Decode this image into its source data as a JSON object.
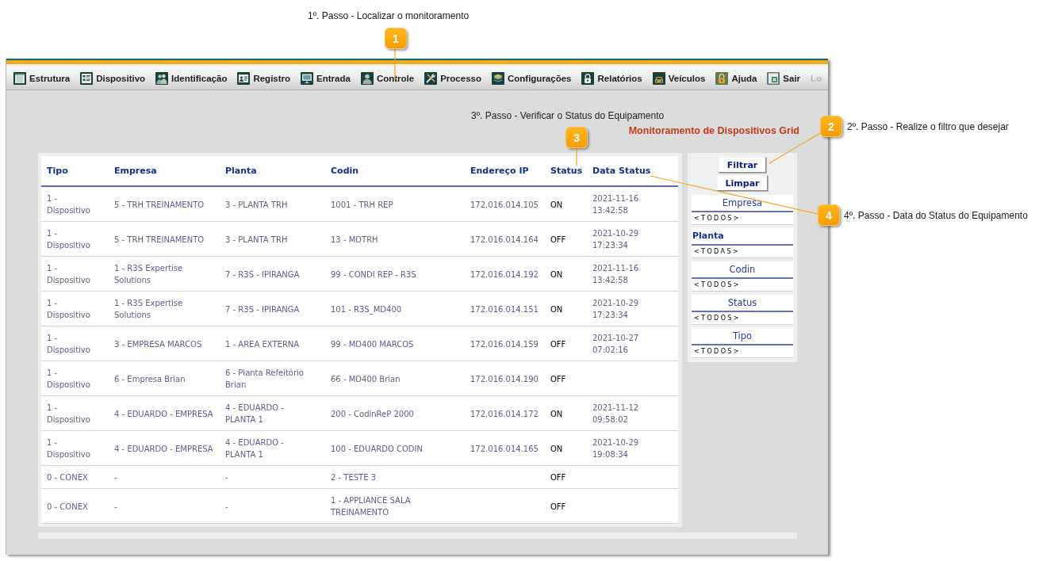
{
  "annotations": [
    {
      "number": "1",
      "caption": "1º. Passo - Localizar o monitoramento"
    },
    {
      "number": "3",
      "caption": "3º. Passo - Verificar o Status do Equipamento"
    },
    {
      "number": "2",
      "caption": "2º. Passo - Realize o filtro que desejar"
    },
    {
      "number": "4",
      "caption": "4º. Passo - Data do Status do Equipamento"
    }
  ],
  "menu": {
    "items": [
      {
        "label": "Estrutura",
        "disabled": false
      },
      {
        "label": "Dispositivo",
        "disabled": false
      },
      {
        "label": "Identificação",
        "disabled": false
      },
      {
        "label": "Registro",
        "disabled": false
      },
      {
        "label": "Entrada",
        "disabled": false
      },
      {
        "label": "Controle",
        "disabled": false
      },
      {
        "label": "Processo",
        "disabled": false
      },
      {
        "label": "Configurações",
        "disabled": false
      },
      {
        "label": "Relatórios",
        "disabled": false
      },
      {
        "label": "Veículos",
        "disabled": false
      },
      {
        "label": "Ajuda",
        "disabled": false
      },
      {
        "label": "Sair",
        "disabled": false
      },
      {
        "label": "Lo",
        "disabled": true
      }
    ]
  },
  "title": "Monitoramento de Dispositivos Grid",
  "table": {
    "columns": [
      "Tipo",
      "Empresa",
      "Planta",
      "Codin",
      "Endereço IP",
      "Status",
      "Data Status"
    ],
    "rows": [
      {
        "tipo": "1 - Dispositivo",
        "empresa": "5 - TRH TREINAMENTO",
        "planta": "3 - PLANTA TRH",
        "codin": "1001 - TRH REP",
        "endereco_ip": "172.016.014.105",
        "status": "ON",
        "data_status": "2021-11-16 13:42:58"
      },
      {
        "tipo": "1 - Dispositivo",
        "empresa": "5 - TRH TREINAMENTO",
        "planta": "3 - PLANTA TRH",
        "codin": "13 - MDTRH",
        "endereco_ip": "172.016.014.164",
        "status": "OFF",
        "data_status": "2021-10-29 17:23:34"
      },
      {
        "tipo": "1 - Dispositivo",
        "empresa": "1 - R3S Expertise Solutions",
        "planta": "7 - R3S - IPIRANGA",
        "codin": "99 - CONDI REP - R3S",
        "endereco_ip": "172.016.014.192",
        "status": "ON",
        "data_status": "2021-11-16 13:42:58"
      },
      {
        "tipo": "1 - Dispositivo",
        "empresa": "1 - R3S Expertise Solutions",
        "planta": "7 - R3S - IPIRANGA",
        "codin": "101 - R3S_MD400",
        "endereco_ip": "172.016.014.151",
        "status": "ON",
        "data_status": "2021-10-29 17:23:34"
      },
      {
        "tipo": "1 - Dispositivo",
        "empresa": "3 - EMPRESA MARCOS",
        "planta": "1 - AREA EXTERNA",
        "codin": "99 - MD400 MARCOS",
        "endereco_ip": "172.016.014.159",
        "status": "OFF",
        "data_status": "2021-10-27 07:02:16"
      },
      {
        "tipo": "1 - Dispositivo",
        "empresa": "6 - Empresa Brian",
        "planta": "6 - Planta Refeitório Brian",
        "codin": "66 - MD400 Brian",
        "endereco_ip": "172.016.014.190",
        "status": "OFF"
      },
      {
        "tipo": "1 - Dispositivo",
        "empresa": "4 - EDUARDO - EMPRESA",
        "planta": "4 - EDUARDO - PLANTA 1",
        "codin": "200 - CodinReP 2000",
        "endereco_ip": "172.016.014.172",
        "status": "ON",
        "data_status": "2021-11-12 09:58:02"
      },
      {
        "tipo": "1 - Dispositivo",
        "empresa": "4 - EDUARDO - EMPRESA",
        "planta": "4 - EDUARDO - PLANTA 1",
        "codin": "100 - EDUARDO CODIN",
        "endereco_ip": "172.016.014.165",
        "status": "ON",
        "data_status": "2021-10-29 19:08:34"
      },
      {
        "tipo": "0 - CONEX",
        "empresa": "-",
        "planta": "-",
        "codin": "2 - TESTE 3",
        "status": "OFF"
      },
      {
        "tipo": "0 - CONEX",
        "empresa": "-",
        "planta": "-",
        "codin": "1 - APPLIANCE SALA TREINAMENTO",
        "status": "OFF"
      }
    ]
  },
  "filter_panel": {
    "buttons": [
      "Filtrar",
      "Limpar"
    ],
    "filters": [
      {
        "label": "Empresa",
        "kind": "plain",
        "value": "<TODOS>"
      },
      {
        "label": "Planta",
        "kind": "emphasized",
        "value": "<TODAS>"
      },
      {
        "label": "Codin",
        "kind": "plain",
        "value": "<TODOS>"
      },
      {
        "label": "Status",
        "kind": "plain",
        "value": "<TODOS>"
      },
      {
        "label": "Tipo",
        "kind": "plain",
        "value": "<TODOS>"
      }
    ]
  }
}
